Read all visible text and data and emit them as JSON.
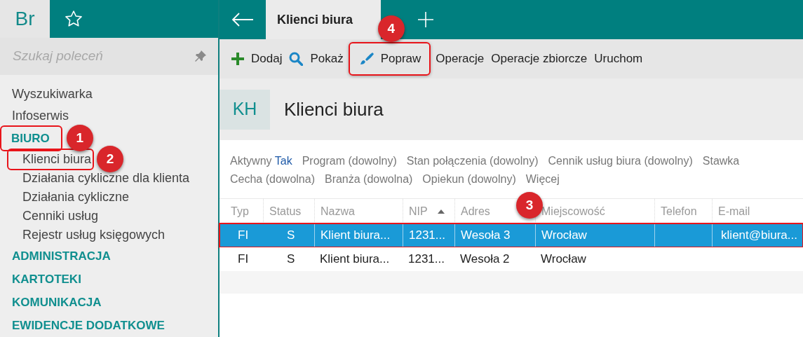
{
  "app": {
    "logo": "Br"
  },
  "tabs": [
    {
      "label": "Klienci biura",
      "selected": true
    }
  ],
  "sidebar": {
    "search": {
      "placeholder": "Szukaj poleceń"
    },
    "items": [
      {
        "label": "Wyszukiwarka",
        "kind": "link"
      },
      {
        "label": "Infoserwis",
        "kind": "link"
      },
      {
        "label": "BIURO",
        "kind": "section",
        "annotated": true,
        "callout": "1",
        "children": [
          {
            "label": "Klienci biura",
            "annotated": true,
            "callout": "2"
          },
          {
            "label": "Działania cykliczne dla klienta",
            "annotated": false
          },
          {
            "label": "Działania cykliczne",
            "annotated": false
          },
          {
            "label": "Cenniki usług",
            "annotated": false
          },
          {
            "label": "Rejestr usług księgowych",
            "annotated": false
          }
        ]
      },
      {
        "label": "ADMINISTRACJA",
        "kind": "section",
        "annotated": false
      },
      {
        "label": "KARTOTEKI",
        "kind": "section",
        "annotated": false
      },
      {
        "label": "KOMUNIKACJA",
        "kind": "section",
        "annotated": false
      },
      {
        "label": "EWIDENCJE DODATKOWE",
        "kind": "section",
        "annotated": false
      }
    ]
  },
  "toolbar": [
    {
      "label": "Dodaj",
      "kind": "plus",
      "annotated": false
    },
    {
      "label": "Pokaż",
      "kind": "search",
      "annotated": false
    },
    {
      "label": "Popraw",
      "kind": "brush",
      "annotated": true,
      "callout": "4"
    },
    {
      "label": "Operacje",
      "kind": "text",
      "annotated": false
    },
    {
      "label": "Operacje zbiorcze",
      "kind": "text",
      "annotated": false
    },
    {
      "label": "Uruchom",
      "kind": "text",
      "annotated": false
    }
  ],
  "header": {
    "badge": "KH",
    "title": "Klienci biura"
  },
  "filters": [
    [
      {
        "label": "Aktywny",
        "value": "Tak"
      },
      {
        "label": "Program (dowolny)"
      },
      {
        "label": "Stan połączenia (dowolny)"
      },
      {
        "label": "Cennik usług biura (dowolny)"
      },
      {
        "label": "Stawka"
      }
    ],
    [
      {
        "label": "Cecha (dowolna)"
      },
      {
        "label": "Branża (dowolna)"
      },
      {
        "label": "Opiekun (dowolny)"
      },
      {
        "label": "Więcej"
      }
    ]
  ],
  "table": {
    "columns": [
      {
        "label": "Typ",
        "sorted": false
      },
      {
        "label": "Status",
        "sorted": false
      },
      {
        "label": "Nazwa",
        "sorted": false
      },
      {
        "label": "NIP",
        "sorted": true
      },
      {
        "label": "Adres",
        "sorted": false
      },
      {
        "label": "Miejscowość",
        "sorted": false
      },
      {
        "label": "Telefon",
        "sorted": false
      },
      {
        "label": "E-mail",
        "sorted": false
      }
    ],
    "rows": [
      {
        "selected": true,
        "annotated": true,
        "callout": "3",
        "cells": [
          "FI",
          "S",
          "Klient biura...",
          "1231...",
          "Wesoła 3",
          "Wrocław",
          "",
          "klient@biura..."
        ]
      },
      {
        "selected": false,
        "annotated": false,
        "cells": [
          "FI",
          "S",
          "Klient biura...",
          "1231...",
          "Wesoła 2",
          "Wrocław",
          "",
          ""
        ]
      }
    ]
  }
}
